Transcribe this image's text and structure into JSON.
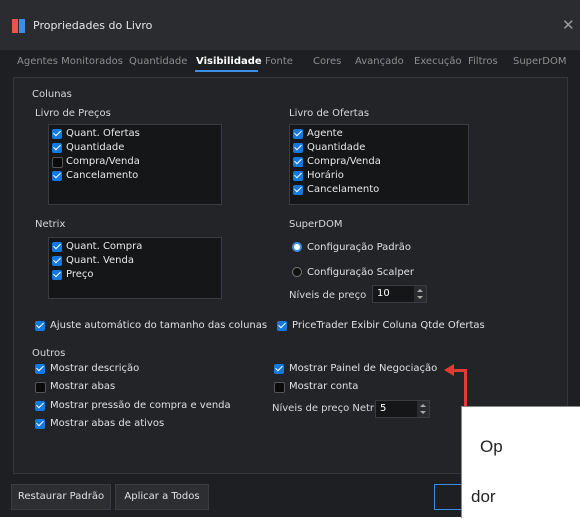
{
  "window": {
    "title": "Propriedades do Livro"
  },
  "tabs": [
    "Agentes Monitorados",
    "Quantidade",
    "Visibilidade",
    "Fonte",
    "Cores",
    "Avançado",
    "Execução",
    "Filtros",
    "SuperDOM"
  ],
  "active_tab": "Visibilidade",
  "colunas": {
    "section_label": "Colunas",
    "livro_precos": {
      "label": "Livro de Preços",
      "items": [
        {
          "label": "Quant. Ofertas",
          "checked": true
        },
        {
          "label": "Quantidade",
          "checked": true
        },
        {
          "label": "Compra/Venda",
          "checked": false
        },
        {
          "label": "Cancelamento",
          "checked": true
        }
      ]
    },
    "livro_ofertas": {
      "label": "Livro de Ofertas",
      "items": [
        {
          "label": "Agente",
          "checked": true
        },
        {
          "label": "Quantidade",
          "checked": true
        },
        {
          "label": "Compra/Venda",
          "checked": true
        },
        {
          "label": "Horário",
          "checked": true
        },
        {
          "label": "Cancelamento",
          "checked": true
        }
      ]
    },
    "netrix": {
      "label": "Netrix",
      "items": [
        {
          "label": "Quant. Compra",
          "checked": true
        },
        {
          "label": "Quant. Venda",
          "checked": true
        },
        {
          "label": "Preço",
          "checked": true
        }
      ]
    },
    "superdom": {
      "label": "SuperDOM",
      "options": [
        {
          "label": "Configuração Padrão",
          "selected": true
        },
        {
          "label": "Configuração Scalper",
          "selected": false
        }
      ],
      "niveis_label": "Níveis de preço",
      "niveis_value": "10"
    },
    "ajuste": {
      "label": "Ajuste automático do tamanho das colunas",
      "checked": true
    },
    "pricetrader": {
      "label": "PriceTrader Exibir Coluna Qtde Ofertas",
      "checked": true
    }
  },
  "outros": {
    "section_label": "Outros",
    "left": [
      {
        "label": "Mostrar descrição",
        "checked": true
      },
      {
        "label": "Mostrar abas",
        "checked": false
      },
      {
        "label": "Mostrar pressão de compra e venda",
        "checked": true
      },
      {
        "label": "Mostrar abas de ativos",
        "checked": true
      }
    ],
    "right": [
      {
        "label": "Mostrar Painel de Negociação",
        "checked": true
      },
      {
        "label": "Mostrar conta",
        "checked": false
      }
    ],
    "niveis_netrix_label": "Níveis de preço Netrix",
    "niveis_netrix_value": "5"
  },
  "buttons": {
    "restaurar": "Restaurar Padrão",
    "aplicar": "Aplicar a Todos",
    "ok": ""
  },
  "annotation": {
    "line1": "Op",
    "line2": "dor"
  },
  "colors": {
    "accent": "#1279e0",
    "annotation_red": "#e53935",
    "background": "#1e1f22"
  }
}
